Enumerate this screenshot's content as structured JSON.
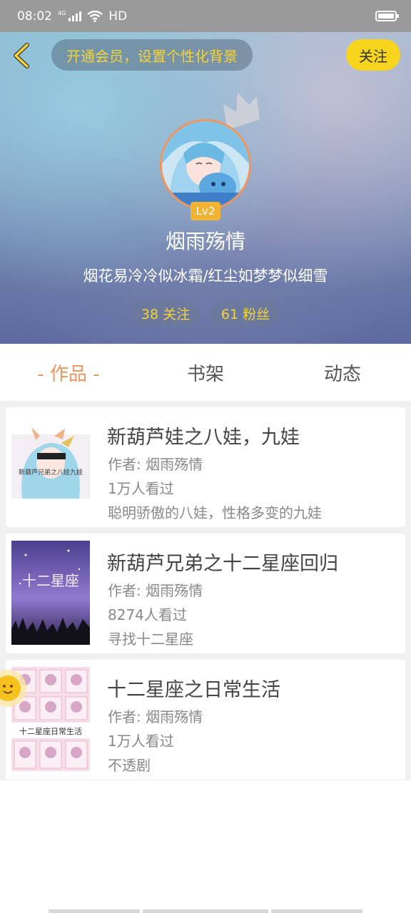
{
  "status_bar": {
    "time": "08:02",
    "network": "4G",
    "hd": "HD"
  },
  "header": {
    "vip_prompt": "开通会员，设置个性化背景",
    "follow_label": "关注",
    "level": "Lv2",
    "nickname": "烟雨殇情",
    "signature": "烟花易冷冷似冰霜/红尘如梦梦似细雪",
    "following": "38 关注",
    "fans": "61 粉丝"
  },
  "tabs": [
    {
      "label": "- 作品 -",
      "active": true
    },
    {
      "label": "书架",
      "active": false
    },
    {
      "label": "动态",
      "active": false
    }
  ],
  "works": [
    {
      "title": "新葫芦娃之八娃，九娃",
      "author": "作者: 烟雨殇情",
      "views": "1万人看过",
      "desc": "聪明骄傲的八娃，性格多变的九娃",
      "cover_text": "新葫芦兄弟之八娃九娃"
    },
    {
      "title": "新葫芦兄弟之十二星座回归",
      "author": "作者: 烟雨殇情",
      "views": "8274人看过",
      "desc": "寻找十二星座",
      "cover_text": "十二星座"
    },
    {
      "title": "十二星座之日常生活",
      "author": "作者: 烟雨殇情",
      "views": "1万人看过",
      "desc": "不透剧",
      "cover_text": "十二星座日常生活"
    }
  ],
  "colors": {
    "accent": "#f0955e",
    "gold": "#f5d437",
    "follow_bg": "#f7d51d",
    "level_bg": "#f2b233"
  }
}
